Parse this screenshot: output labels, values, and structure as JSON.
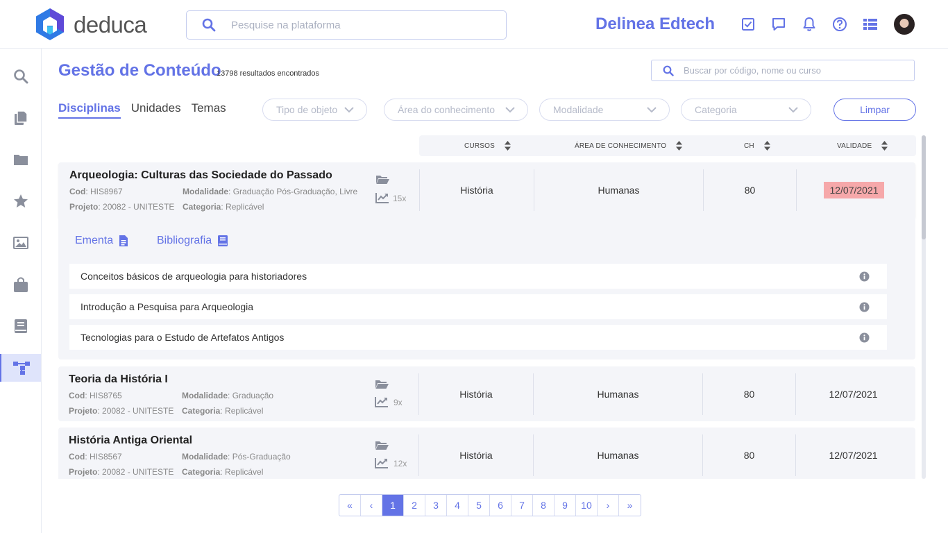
{
  "header": {
    "logo_text": "deduca",
    "search_placeholder": "Pesquise na plataforma",
    "org_name": "Delinea Edtech",
    "icons": [
      "tasks-checkbox-icon",
      "chat-icon",
      "bell-icon",
      "help-icon",
      "list-icon"
    ]
  },
  "sidebar": {
    "items": [
      {
        "icon": "search-icon"
      },
      {
        "icon": "documents-icon"
      },
      {
        "icon": "folder-icon"
      },
      {
        "icon": "star-icon"
      },
      {
        "icon": "image-icon"
      },
      {
        "icon": "bag-icon"
      },
      {
        "icon": "book-icon"
      },
      {
        "icon": "hierarchy-icon",
        "active": true
      }
    ]
  },
  "page": {
    "title": "Gestão de Conteúdo",
    "result_count": "13798 resultados encontrados",
    "code_search_placeholder": "Buscar por código, nome ou curso"
  },
  "tabs": [
    {
      "label": "Disciplinas",
      "active": true
    },
    {
      "label": "Unidades"
    },
    {
      "label": "Temas"
    }
  ],
  "filters": {
    "tipo": "Tipo de objeto",
    "area": "Área do conhecimento",
    "modalidade": "Modalidade",
    "categoria": "Categoria",
    "clear_label": "Limpar"
  },
  "columns": {
    "cursos": "CURSOS",
    "area": "ÁREA DE CONHECIMENTO",
    "ch": "CH",
    "validade": "VALIDADE"
  },
  "labels": {
    "cod": "Cod",
    "modalidade": "Modalidade",
    "projeto": "Projeto",
    "categoria": "Categoria"
  },
  "rows": [
    {
      "title": "Arqueologia: Culturas das Sociedade do Passado",
      "cod": "HIS8967",
      "modalidade": "Graduação Pós-Graduação, Livre",
      "projeto": "20082 - UNITESTE",
      "categoria": "Replicável",
      "views": "15x",
      "curso": "História",
      "area": "Humanas",
      "ch": "80",
      "validade": "12/07/2021",
      "expired": true
    },
    {
      "title": "Teoria da História I",
      "cod": "HIS8765",
      "modalidade": "Graduação",
      "projeto": "20082 - UNITESTE",
      "categoria": "Replicável",
      "views": "9x",
      "curso": "História",
      "area": "Humanas",
      "ch": "80",
      "validade": "12/07/2021",
      "expired": false
    },
    {
      "title": "História Antiga Oriental",
      "cod": "HIS8567",
      "modalidade": "Pós-Graduação",
      "projeto": "20082 - UNITESTE",
      "categoria": "Replicável",
      "views": "12x",
      "curso": "História",
      "area": "Humanas",
      "ch": "80",
      "validade": "12/07/2021",
      "expired": false
    }
  ],
  "expanded": {
    "ementa_label": "Ementa",
    "bibliografia_label": "Bibliografia",
    "topics": [
      "Conceitos básicos de arqueologia para historiadores",
      "Introdução a Pesquisa para Arqueologia",
      "Tecnologias para o Estudo de Artefatos Antigos"
    ]
  },
  "pagination": {
    "first": "«",
    "prev": "‹",
    "pages": [
      "1",
      "2",
      "3",
      "4",
      "5",
      "6",
      "7",
      "8",
      "9",
      "10"
    ],
    "current": "1",
    "next": "›",
    "last": "»"
  },
  "colors": {
    "accent": "#6373e6",
    "card_bg": "#f4f5f9",
    "expired_badge": "#f6a8aa",
    "icon_gray": "#8a8f9c"
  }
}
